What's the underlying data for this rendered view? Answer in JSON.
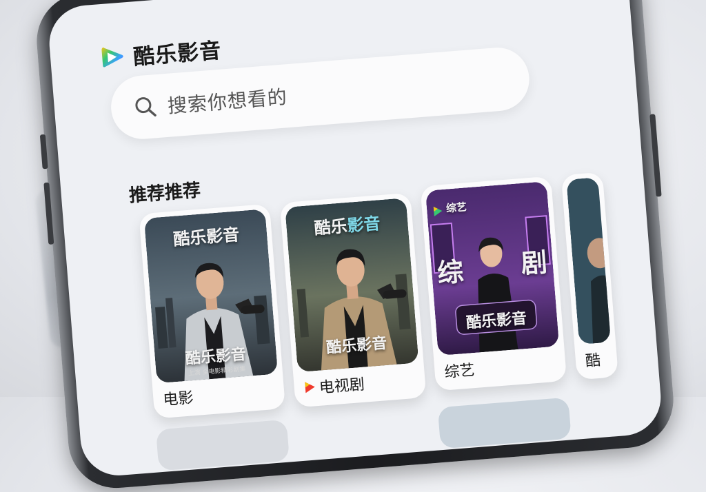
{
  "app": {
    "name": "酷乐影音"
  },
  "search": {
    "placeholder": "搜索你想看的"
  },
  "section": {
    "title": "推荐推荐"
  },
  "cards": [
    {
      "label": "电影",
      "poster_top": "酷乐影音",
      "poster_bottom": "酷乐影音",
      "poster_caption": "上演 全电影精彩剧集"
    },
    {
      "label": "电视剧",
      "poster_top_a": "酷乐",
      "poster_top_b": "影音",
      "poster_bottom": "酷乐影音"
    },
    {
      "label": "综艺",
      "poster_badge": "综艺",
      "poster_char_a": "综",
      "poster_char_b": "剧",
      "poster_bottom": "酷乐影音"
    },
    {
      "label": "酷"
    }
  ],
  "colors": {
    "brand_blue": "#3aa0ff",
    "brand_green": "#37c771",
    "brand_yellow": "#f5c518",
    "brand_purple": "#8a5cf5",
    "accent_red": "#f03a2c"
  }
}
